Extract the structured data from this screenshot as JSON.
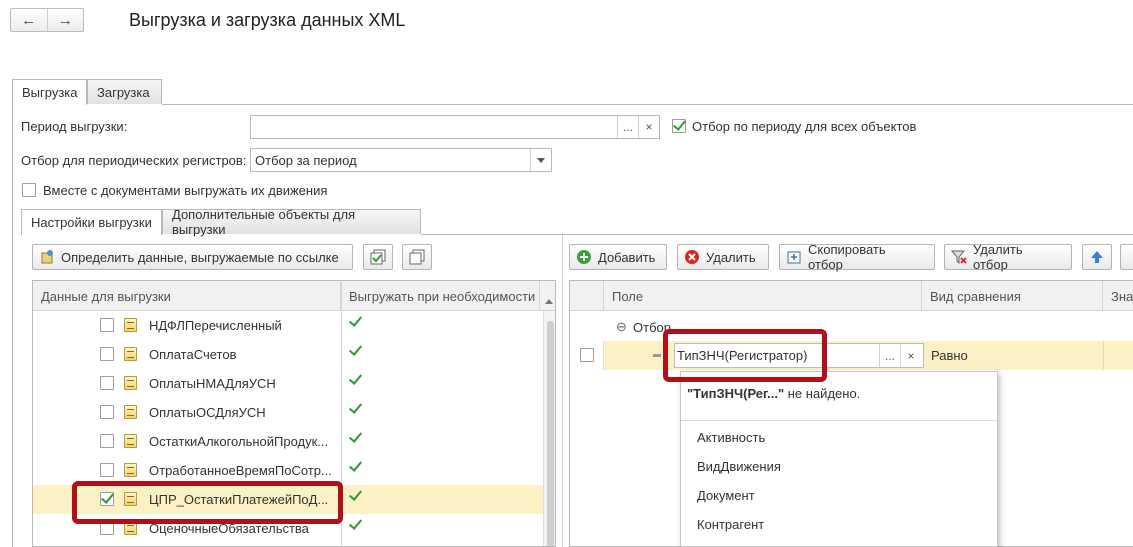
{
  "window": {
    "title": "Выгрузка и загрузка данных XML",
    "nav": {
      "back_icon": "←",
      "forward_icon": "→"
    }
  },
  "tabs": [
    "Выгрузка",
    "Загрузка"
  ],
  "export": {
    "period_label": "Период выгрузки:",
    "period_value": "",
    "period_select_btn": "...",
    "period_clear_btn": "×",
    "filter_all_label": "Отбор по периоду для всех объектов",
    "periodic_label": "Отбор для периодических регистров:",
    "periodic_value": "Отбор за период",
    "with_docs_label": "Вместе с документами выгружать их движения",
    "subtabs": [
      "Настройки выгрузки",
      "Дополнительные объекты для выгрузки"
    ],
    "define_button": "Определить данные, выгружаемые по ссылке"
  },
  "left_grid": {
    "columns": [
      "Данные для выгрузки",
      "Выгружать при необходимости"
    ],
    "rows": [
      {
        "name": "НДФЛПеречисленный",
        "checked": false,
        "export_if_needed": true
      },
      {
        "name": "ОплатаСчетов",
        "checked": false,
        "export_if_needed": true
      },
      {
        "name": "ОплатыНМАДляУСН",
        "checked": false,
        "export_if_needed": true
      },
      {
        "name": "ОплатыОСДляУСН",
        "checked": false,
        "export_if_needed": true
      },
      {
        "name": "ОстаткиАлкогольнойПродук...",
        "checked": false,
        "export_if_needed": true
      },
      {
        "name": "ОтработанноеВремяПоСотр...",
        "checked": false,
        "export_if_needed": true
      },
      {
        "name": "ЦПР_ОстаткиПлатежейПоД...",
        "checked": true,
        "export_if_needed": true,
        "selected": true
      },
      {
        "name": "ОценочныеОбязательства",
        "checked": false,
        "export_if_needed": true
      }
    ]
  },
  "right_toolbar": {
    "add": "Добавить",
    "delete": "Удалить",
    "copy_filter": "Скопировать отбор",
    "delete_filter": "Удалить отбор"
  },
  "right_grid": {
    "columns": [
      "Поле",
      "Вид сравнения",
      "Зна"
    ],
    "group_label": "Отбор",
    "row": {
      "field_value": "ТипЗНЧ(Регистратор)",
      "comparison": "Равно",
      "select_btn": "...",
      "clear_btn": "×"
    }
  },
  "dropdown": {
    "not_found_bold": "\"ТипЗНЧ(Рег...\"",
    "not_found_rest": " не найдено.",
    "items": [
      "Активность",
      "ВидДвижения",
      "Документ",
      "Контрагент"
    ]
  },
  "colors": {
    "highlight": "#b0101a",
    "selected_row": "#fbf1c4",
    "check_green": "#2e9a2e"
  }
}
